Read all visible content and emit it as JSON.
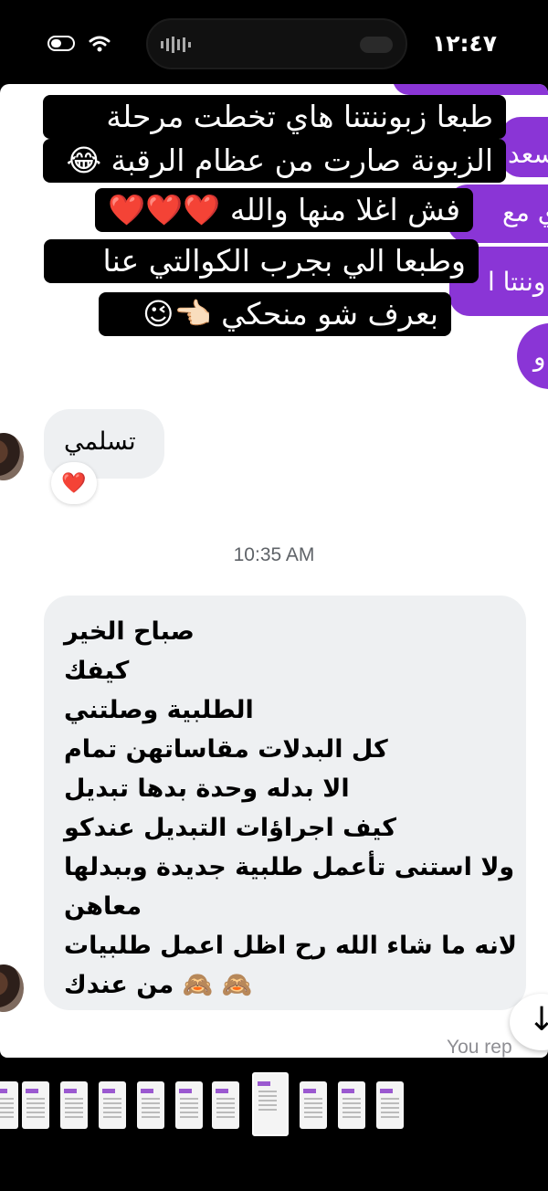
{
  "status_bar": {
    "time": "١٢:٤٧"
  },
  "chat": {
    "sent_fragments": [
      "سعد",
      "ي مع",
      "وننتا ا",
      "و"
    ],
    "story_reply": {
      "lines": [
        "طبعا زبوننتنا هاي تخطت مرحلة",
        "الزبونة صارت من عظام الرقبة 😂",
        "فش اغلا منها والله ❤️❤️❤️",
        "وطبعا الي بجرب الكوالتي عنا",
        "بعرف شو منحكي 👈🏻😉"
      ]
    },
    "messages": [
      {
        "text": "تسلمي",
        "reaction": "❤️"
      }
    ],
    "timestamp": "10:35 AM",
    "long_message": {
      "lines": [
        "صباح الخير",
        "كيفك",
        "الطلبية وصلتني",
        "كل البدلات مقاساتهن تمام",
        "الا بدله وحدة بدها تبديل",
        "كيف اجراؤات التبديل عندكو",
        "ولا استنى تأعمل طلبية جديدة وببدلها",
        "معاهن",
        "لانه ما شاء الله رح اظل اعمل طلبيات",
        "من عندك 🙈 🙈"
      ]
    },
    "scroll_down_icon": "arrow-down-icon",
    "you_replied": "You rep"
  },
  "thumbnail_strip": {
    "count": 11,
    "selected_index": 6
  },
  "colors": {
    "sent_bubble": "#8a35d6",
    "received_bubble": "#eef0f2",
    "story_bg": "#000000"
  }
}
